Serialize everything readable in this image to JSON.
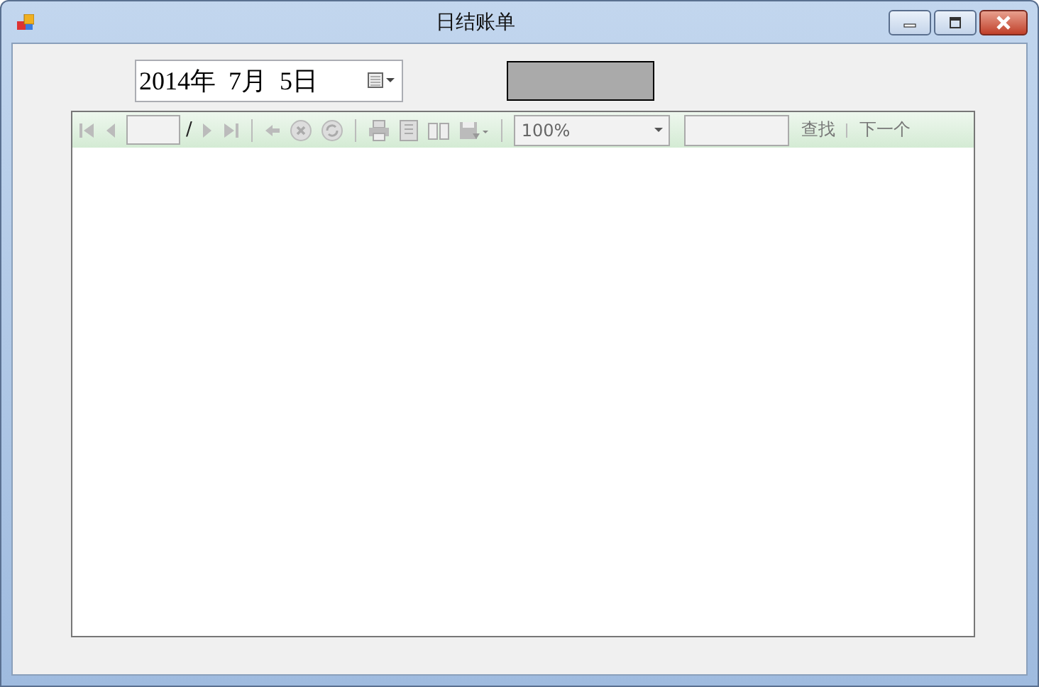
{
  "window": {
    "title": "日结账单"
  },
  "date_picker": {
    "value": "2014年  7月  5日"
  },
  "report_toolbar": {
    "page_separator": "/",
    "zoom": {
      "value": "100%"
    },
    "find_button": {
      "label": "查找",
      "disabled": true
    },
    "next_button": {
      "label": "下一个",
      "disabled": true
    }
  }
}
